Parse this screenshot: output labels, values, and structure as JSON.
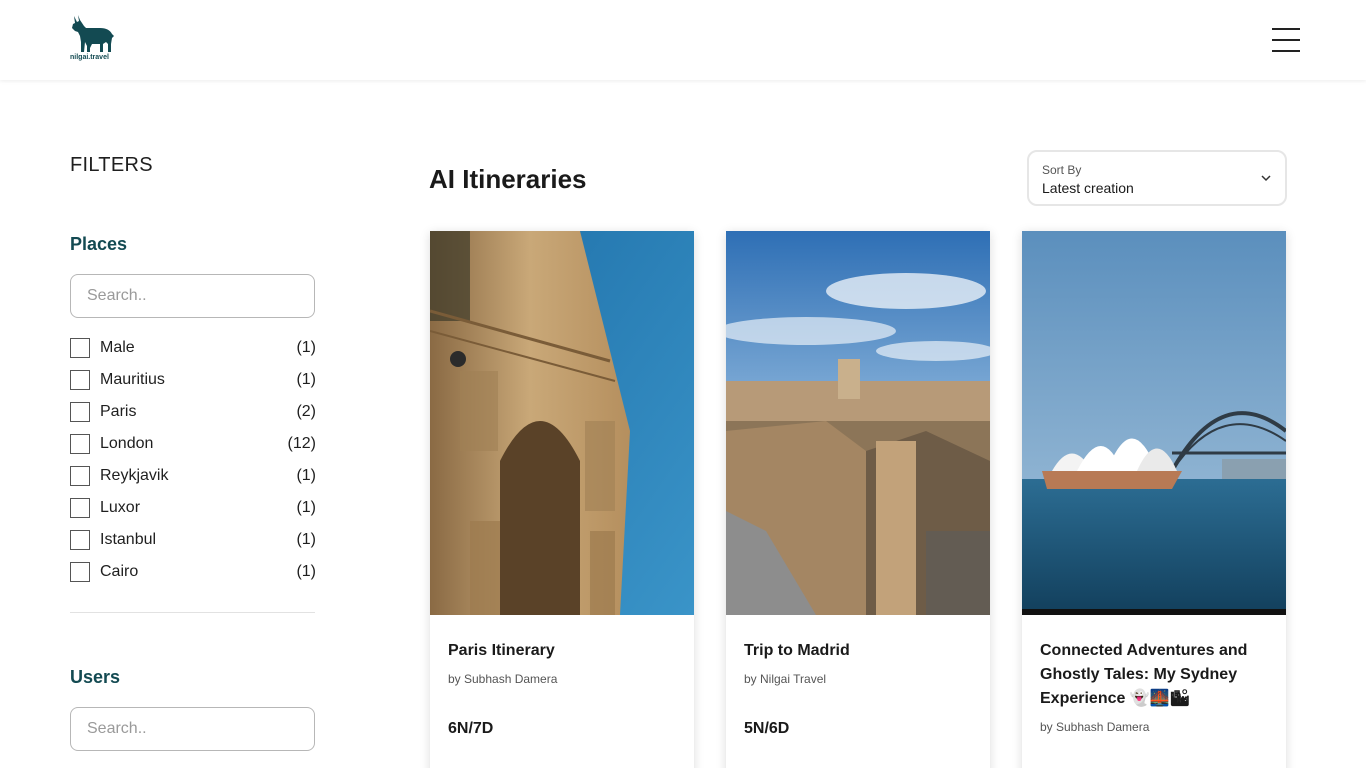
{
  "header": {
    "logo_text": "nilgai.travel"
  },
  "sidebar": {
    "filters_title": "FILTERS",
    "places_title": "Places",
    "places_search_placeholder": "Search..",
    "places": [
      {
        "label": "Male",
        "count": "(1)"
      },
      {
        "label": "Mauritius",
        "count": "(1)"
      },
      {
        "label": "Paris",
        "count": "(2)"
      },
      {
        "label": "London",
        "count": "(12)"
      },
      {
        "label": "Reykjavik",
        "count": "(1)"
      },
      {
        "label": "Luxor",
        "count": "(1)"
      },
      {
        "label": "Istanbul",
        "count": "(1)"
      },
      {
        "label": "Cairo",
        "count": "(1)"
      }
    ],
    "users_title": "Users",
    "users_search_placeholder": "Search.."
  },
  "main": {
    "title": "AI Itineraries",
    "sort": {
      "label": "Sort By",
      "value": "Latest creation"
    },
    "cards": [
      {
        "title": "Paris Itinerary",
        "author": "by Subhash Damera",
        "duration": "6N/7D",
        "image": "arc-de-triomphe-photo"
      },
      {
        "title": "Trip to Madrid",
        "author": "by Nilgai Travel",
        "duration": "5N/6D",
        "image": "madrid-cityscape-photo"
      },
      {
        "title": "Connected Adventures and Ghostly Tales: My Sydney Experience 👻🌉🏙",
        "author": "by Subhash Damera",
        "duration": "",
        "image": "sydney-opera-house-photo"
      }
    ]
  },
  "colors": {
    "brand": "#134a52",
    "text": "#1f1f1f"
  }
}
